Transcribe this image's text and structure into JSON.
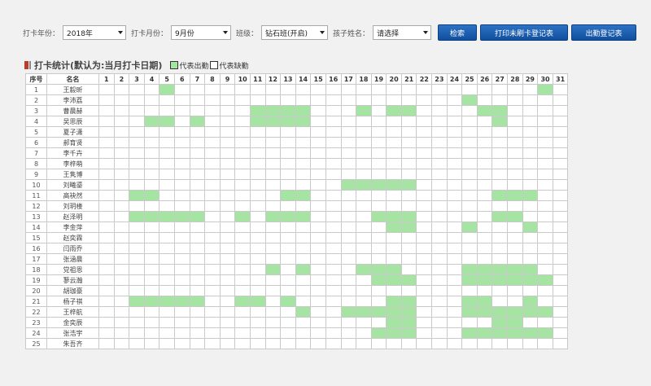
{
  "toolbar": {
    "year_label": "打卡年份：",
    "year_value": "2018年",
    "month_label": "打卡月份：",
    "month_value": "9月份",
    "class_label": "班级：",
    "class_value": "钻石班(开启)",
    "child_label": "孩子姓名：",
    "child_value": "请选择",
    "search_button": "检索",
    "print_unpunched_button": "打印未刷卡登记表",
    "print_attendance_button": "出勤登记表"
  },
  "section": {
    "title": "打卡统计(默认为:当月打卡日期)",
    "legend_present_color": "#a6e4a3",
    "legend_present": "代表出勤",
    "legend_absent_color": "#ffffff",
    "legend_absent": "代表缺勤"
  },
  "table": {
    "seq_header": "序号",
    "name_header": "名名",
    "days": [
      "1",
      "2",
      "3",
      "4",
      "5",
      "6",
      "7",
      "8",
      "9",
      "10",
      "11",
      "12",
      "13",
      "14",
      "15",
      "16",
      "17",
      "18",
      "19",
      "20",
      "21",
      "22",
      "23",
      "24",
      "25",
      "26",
      "27",
      "28",
      "29",
      "30",
      "31"
    ],
    "present_color": "#a6e4a3",
    "rows": [
      {
        "seq": "1",
        "name": "王毅昕",
        "present": [
          5,
          30
        ]
      },
      {
        "seq": "2",
        "name": "李沛荔",
        "present": [
          25
        ]
      },
      {
        "seq": "3",
        "name": "曹晨赫",
        "present": [
          11,
          12,
          13,
          14,
          18,
          20,
          21,
          26,
          27
        ]
      },
      {
        "seq": "4",
        "name": "吴思辰",
        "present": [
          4,
          5,
          7,
          11,
          12,
          13,
          14,
          27
        ]
      },
      {
        "seq": "5",
        "name": "夏子潇",
        "present": []
      },
      {
        "seq": "6",
        "name": "郝育贤",
        "present": []
      },
      {
        "seq": "7",
        "name": "李千卉",
        "present": []
      },
      {
        "seq": "8",
        "name": "李梓萌",
        "present": []
      },
      {
        "seq": "9",
        "name": "王隽博",
        "present": []
      },
      {
        "seq": "10",
        "name": "刘曦鎏",
        "present": [
          17,
          18,
          19,
          20,
          21
        ]
      },
      {
        "seq": "11",
        "name": "高袂然",
        "present": [
          3,
          4,
          13,
          14,
          27,
          28,
          29
        ]
      },
      {
        "seq": "12",
        "name": "刘玥楼",
        "present": []
      },
      {
        "seq": "13",
        "name": "赵泽明",
        "present": [
          3,
          4,
          5,
          6,
          7,
          10,
          12,
          13,
          14,
          19,
          20,
          21,
          27,
          28
        ]
      },
      {
        "seq": "14",
        "name": "李金萍",
        "present": [
          20,
          21,
          25,
          29
        ]
      },
      {
        "seq": "15",
        "name": "赵奕霖",
        "present": []
      },
      {
        "seq": "16",
        "name": "闫雨乔",
        "present": []
      },
      {
        "seq": "17",
        "name": "张涵晨",
        "present": []
      },
      {
        "seq": "18",
        "name": "党祖恩",
        "present": [
          12,
          14,
          18,
          19,
          20,
          25,
          26,
          27,
          28,
          29
        ]
      },
      {
        "seq": "19",
        "name": "蓼云瀚",
        "present": [
          19,
          20,
          21,
          25,
          26,
          27,
          28,
          29,
          30
        ]
      },
      {
        "seq": "20",
        "name": "胡珈豪",
        "present": []
      },
      {
        "seq": "21",
        "name": "杨子祺",
        "present": [
          3,
          4,
          5,
          6,
          7,
          10,
          11,
          13,
          20,
          21,
          25,
          26,
          29
        ]
      },
      {
        "seq": "22",
        "name": "王梓航",
        "present": [
          14,
          17,
          18,
          19,
          20,
          21,
          25,
          26,
          27,
          28,
          29,
          30
        ]
      },
      {
        "seq": "23",
        "name": "金奕辰",
        "present": [
          20,
          21,
          27,
          28
        ]
      },
      {
        "seq": "24",
        "name": "张浩宇",
        "present": [
          19,
          20,
          21,
          25,
          26,
          27,
          28,
          29,
          30
        ]
      },
      {
        "seq": "25",
        "name": "朱吾齐",
        "present": []
      }
    ]
  }
}
